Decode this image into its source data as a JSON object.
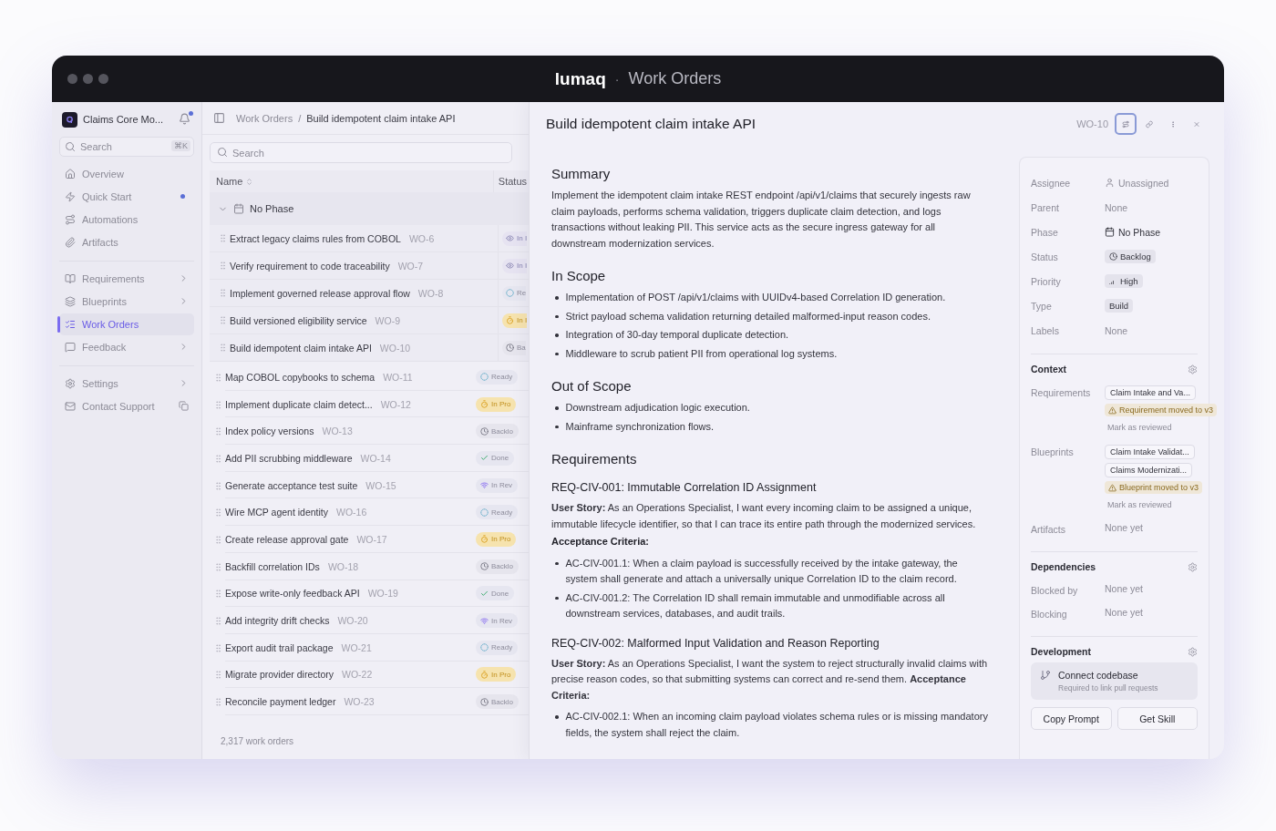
{
  "window": {
    "brand": "lumaq",
    "separator": "·",
    "title": "Work Orders"
  },
  "sidebar": {
    "workspace": "Claims Core Mo...",
    "unread": true,
    "search": {
      "placeholder": "Search",
      "shortcut": "⌘K"
    },
    "groups": [
      [
        {
          "label": "Overview",
          "selected": false,
          "kind": "plain"
        },
        {
          "label": "Quick Start",
          "selected": false,
          "kind": "new"
        },
        {
          "label": "Automations",
          "selected": false,
          "kind": "plain"
        },
        {
          "label": "Artifacts",
          "selected": false,
          "kind": "plain"
        }
      ],
      [
        {
          "label": "Requirements",
          "selected": false,
          "kind": "expandable"
        },
        {
          "label": "Blueprints",
          "selected": false,
          "kind": "expandable"
        },
        {
          "label": "Work Orders",
          "selected": true,
          "kind": "plain"
        },
        {
          "label": "Feedback",
          "selected": false,
          "kind": "expandable"
        }
      ],
      [
        {
          "label": "Settings",
          "selected": false,
          "kind": "expandable"
        },
        {
          "label": "Contact Support",
          "selected": false,
          "kind": "copyable"
        }
      ]
    ]
  },
  "list": {
    "breadcrumb": {
      "parent": "Work Orders",
      "separator": "/",
      "current": "Build idempotent claim intake API"
    },
    "search": {
      "placeholder": "Search"
    },
    "columns": [
      {
        "label": "Name",
        "sortable": true
      },
      {
        "label": "Status"
      }
    ],
    "group": {
      "label": "No Phase",
      "expanded": true,
      "rows": [
        {
          "title": "Extract legacy claims rules from COBOL",
          "id": "WO-6",
          "status": {
            "label": "In I",
            "kind": "review"
          }
        },
        {
          "title": "Verify requirement to code traceability",
          "id": "WO-7",
          "status": {
            "label": "In I",
            "kind": "review"
          }
        },
        {
          "title": "Implement governed release approval flow",
          "id": "WO-8",
          "status": {
            "label": "Re",
            "kind": "ready"
          }
        },
        {
          "title": "Build versioned eligibility service",
          "id": "WO-9",
          "status": {
            "label": "In I",
            "kind": "progress"
          }
        },
        {
          "title": "Build idempotent claim intake API",
          "id": "WO-10",
          "status": {
            "label": "Ba",
            "kind": "backlog"
          }
        }
      ]
    },
    "rows": [
      {
        "title": "Map COBOL copybooks to schema",
        "id": "WO-11",
        "status": {
          "label": "Ready",
          "kind": "ready"
        }
      },
      {
        "title": "Implement duplicate claim detect...",
        "id": "WO-12",
        "status": {
          "label": "In Pro",
          "kind": "progress"
        }
      },
      {
        "title": "Index policy versions",
        "id": "WO-13",
        "status": {
          "label": "Backlo",
          "kind": "backlog"
        }
      },
      {
        "title": "Add PII scrubbing middleware",
        "id": "WO-14",
        "status": {
          "label": "Done",
          "kind": "done"
        }
      },
      {
        "title": "Generate acceptance test suite",
        "id": "WO-15",
        "status": {
          "label": "In Rev",
          "kind": "inrev"
        }
      },
      {
        "title": "Wire MCP agent identity",
        "id": "WO-16",
        "status": {
          "label": "Ready",
          "kind": "ready"
        }
      },
      {
        "title": "Create release approval gate",
        "id": "WO-17",
        "status": {
          "label": "In Pro",
          "kind": "progress"
        }
      },
      {
        "title": "Backfill correlation IDs",
        "id": "WO-18",
        "status": {
          "label": "Backlo",
          "kind": "backlog"
        }
      },
      {
        "title": "Expose write-only feedback API",
        "id": "WO-19",
        "status": {
          "label": "Done",
          "kind": "done"
        }
      },
      {
        "title": "Add integrity drift checks",
        "id": "WO-20",
        "status": {
          "label": "In Rev",
          "kind": "inrev"
        }
      },
      {
        "title": "Export audit trail package",
        "id": "WO-21",
        "status": {
          "label": "Ready",
          "kind": "ready"
        }
      },
      {
        "title": "Migrate provider directory",
        "id": "WO-22",
        "status": {
          "label": "In Pro",
          "kind": "progress"
        }
      },
      {
        "title": "Reconcile payment ledger",
        "id": "WO-23",
        "status": {
          "label": "Backlo",
          "kind": "backlog"
        }
      }
    ],
    "footer": "2,317 work orders"
  },
  "detail": {
    "title": "Build idempotent claim intake API",
    "id": "WO-10",
    "actions": [
      {
        "kind": "relations",
        "selected": true
      },
      {
        "kind": "link",
        "selected": false
      },
      {
        "kind": "more",
        "selected": false
      },
      {
        "kind": "close",
        "selected": false
      }
    ],
    "blocks": [
      {
        "kind": "h2",
        "text": "Summary"
      },
      {
        "kind": "p",
        "text": "Implement the idempotent claim intake REST endpoint /api/v1/claims that securely ingests raw claim payloads, performs schema validation, triggers duplicate claim detection, and logs transactions without leaking PII. This service acts as the secure ingress gateway for all downstream modernization services."
      },
      {
        "kind": "h2",
        "text": "In Scope"
      },
      {
        "kind": "ul",
        "items": [
          "Implementation of POST /api/v1/claims with UUIDv4-based Correlation ID generation.",
          "Strict payload schema validation returning detailed malformed-input reason codes.",
          "Integration of 30-day temporal duplicate detection.",
          "Middleware to scrub patient PII from operational log systems."
        ]
      },
      {
        "kind": "h2",
        "text": "Out of Scope"
      },
      {
        "kind": "ul",
        "items": [
          "Downstream adjudication logic execution.",
          "Mainframe synchronization flows."
        ]
      },
      {
        "kind": "h2",
        "text": "Requirements"
      },
      {
        "kind": "h3",
        "text": "REQ-CIV-001: Immutable Correlation ID Assignment"
      },
      {
        "kind": "p",
        "text": "**User Story:** As an Operations Specialist, I want every incoming claim to be assigned a unique, immutable lifecycle identifier, so that I can trace its entire path through the modernized services."
      },
      {
        "kind": "label",
        "text": "Acceptance Criteria:"
      },
      {
        "kind": "ul",
        "items": [
          "AC-CIV-001.1: When a claim payload is successfully received by the intake gateway, the system shall generate and attach a universally unique Correlation ID to the claim record.",
          "AC-CIV-001.2: The Correlation ID shall remain immutable and unmodifiable across all downstream services, databases, and audit trails."
        ]
      },
      {
        "kind": "h3",
        "text": "REQ-CIV-002: Malformed Input Validation and Reason Reporting"
      },
      {
        "kind": "p",
        "text": "**User Story:** As an Operations Specialist, I want the system to reject structurally invalid claims with precise reason codes, so that submitting systems can correct and re-send them. **Acceptance Criteria:**"
      },
      {
        "kind": "ul",
        "items": [
          "AC-CIV-002.1: When an incoming claim payload violates schema rules or is missing mandatory fields, the system shall reject the claim."
        ]
      }
    ]
  },
  "properties": {
    "fields": [
      {
        "label": "Assignee",
        "value": "Unassigned",
        "kind": "user"
      },
      {
        "label": "Parent",
        "value": "None",
        "kind": "plain"
      },
      {
        "label": "Phase",
        "value": "No Phase",
        "kind": "phase"
      },
      {
        "label": "Status",
        "value": "Backlog",
        "kind": "status"
      },
      {
        "label": "Priority",
        "value": "High",
        "kind": "priority"
      },
      {
        "label": "Type",
        "value": "Build",
        "kind": "tag"
      },
      {
        "label": "Labels",
        "value": "None",
        "kind": "plain"
      }
    ],
    "context": {
      "title": "Context",
      "rows": [
        {
          "label": "Requirements",
          "chips": [
            "Claim Intake and Va..."
          ],
          "warning": "Requirement moved to v3",
          "action": "Mark as reviewed"
        },
        {
          "label": "Blueprints",
          "chips": [
            "Claim Intake Validat...",
            "Claims Modernizati..."
          ],
          "warning": "Blueprint moved to v3",
          "action": "Mark as reviewed"
        },
        {
          "label": "Artifacts",
          "value": "None yet"
        }
      ]
    },
    "dependencies": {
      "title": "Dependencies",
      "rows": [
        {
          "label": "Blocked by",
          "value": "None yet"
        },
        {
          "label": "Blocking",
          "value": "None yet"
        }
      ]
    },
    "development": {
      "title": "Development",
      "connect": {
        "title": "Connect codebase",
        "subtitle": "Required to link pull requests"
      },
      "buttons": [
        "Copy Prompt",
        "Get Skill"
      ]
    }
  }
}
